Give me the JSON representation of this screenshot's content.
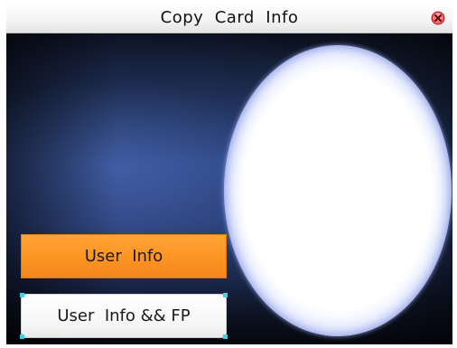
{
  "window": {
    "title": "Copy  Card  Info",
    "close_icon": "close-circle-icon"
  },
  "menu": {
    "items": [
      {
        "label": "User  Info",
        "selected": true
      },
      {
        "label": "User  Info && FP",
        "selected": false
      }
    ]
  },
  "colors": {
    "selected_item": "#ff9a2e",
    "unselected_item": "#ffffff",
    "close_icon": "#e8464e",
    "focus_corner": "#3fd0e8",
    "oval_glow": "#8a9bf0"
  }
}
